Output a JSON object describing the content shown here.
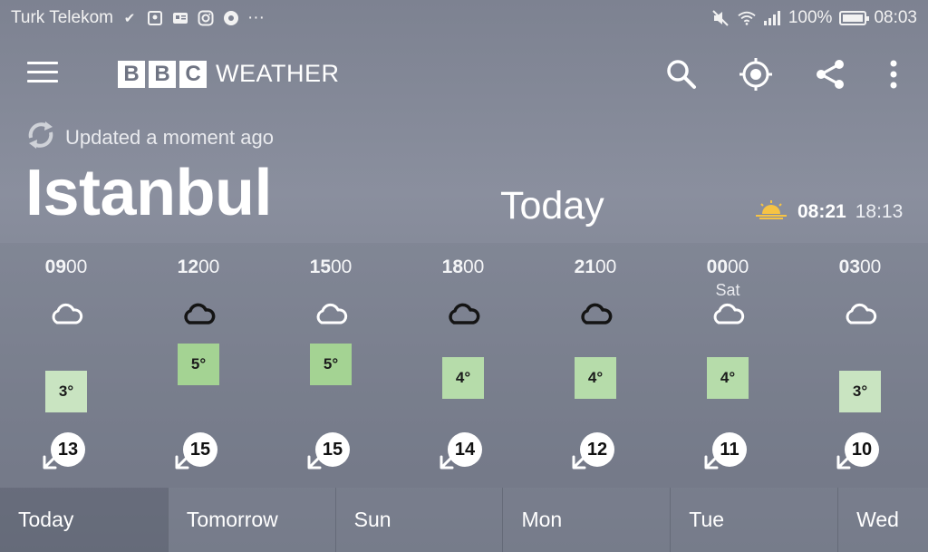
{
  "status_bar": {
    "carrier": "Turk Telekom",
    "battery": "100%",
    "time": "08:03",
    "more": "···"
  },
  "app_bar": {
    "logo_letters": [
      "B",
      "B",
      "C"
    ],
    "logo_word": "WEATHER",
    "icons": [
      "menu-icon",
      "search-icon",
      "location-icon",
      "share-icon",
      "more-vert-icon"
    ]
  },
  "header": {
    "updated": "Updated a moment ago",
    "city": "Istanbul",
    "day": "Today",
    "sunrise": "08:21",
    "sunset": "18:13"
  },
  "hourly": [
    {
      "hour": "09",
      "minutes": "00",
      "day": "",
      "condition": "light-cloud",
      "temp": "3°",
      "temp_color": "#c9e4c1",
      "wind": "13"
    },
    {
      "hour": "12",
      "minutes": "00",
      "day": "",
      "condition": "thick-cloud",
      "temp": "5°",
      "temp_color": "#a4d393",
      "wind": "15"
    },
    {
      "hour": "15",
      "minutes": "00",
      "day": "",
      "condition": "light-cloud",
      "temp": "5°",
      "temp_color": "#a4d393",
      "wind": "15"
    },
    {
      "hour": "18",
      "minutes": "00",
      "day": "",
      "condition": "thick-cloud",
      "temp": "4°",
      "temp_color": "#b6dcaa",
      "wind": "14"
    },
    {
      "hour": "21",
      "minutes": "00",
      "day": "",
      "condition": "thick-cloud",
      "temp": "4°",
      "temp_color": "#b6dcaa",
      "wind": "12"
    },
    {
      "hour": "00",
      "minutes": "00",
      "day": "Sat",
      "condition": "light-cloud",
      "temp": "4°",
      "temp_color": "#b6dcaa",
      "wind": "11"
    },
    {
      "hour": "03",
      "minutes": "00",
      "day": "",
      "condition": "light-cloud",
      "temp": "3°",
      "temp_color": "#c9e4c1",
      "wind": "10"
    }
  ],
  "tabs": [
    "Today",
    "Tomorrow",
    "Sun",
    "Mon",
    "Tue",
    "Wed"
  ],
  "colors": {
    "sun_icon": "#f6c344",
    "background": "#7d8291"
  }
}
